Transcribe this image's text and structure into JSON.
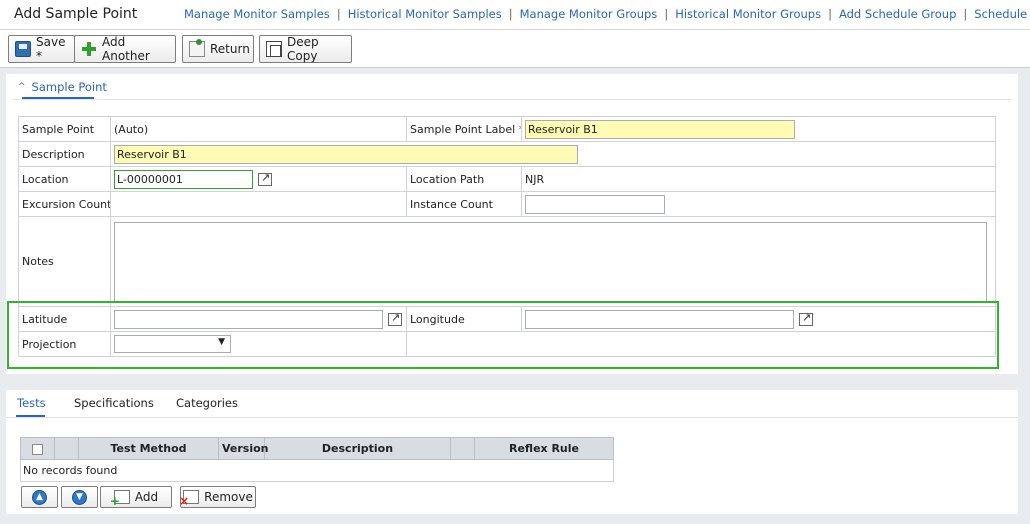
{
  "header": {
    "title": "Add Sample Point",
    "links": [
      "Manage Monitor Samples",
      "Historical Monitor Samples",
      "Manage Monitor Groups",
      "Historical Monitor Groups",
      "Add Schedule Group",
      "Schedule Groups"
    ],
    "separator": "|"
  },
  "toolbar": {
    "save": "Save *",
    "add_another": "Add Another",
    "return": "Return",
    "deep_copy": "Deep Copy"
  },
  "section": {
    "title": "Sample Point"
  },
  "form": {
    "sample_point_label": "Sample Point",
    "sample_point_value": "(Auto)",
    "sample_point_label_label": "Sample Point Label",
    "required_marker": "*",
    "sample_point_label_value": "Reservoir B1",
    "description_label": "Description",
    "description_value": "Reservoir B1",
    "location_label": "Location",
    "location_value": "L-00000001",
    "location_path_label": "Location Path",
    "location_path_value": "NJR",
    "excursion_count_label": "Excursion Count",
    "excursion_count_value": "",
    "instance_count_label": "Instance Count",
    "instance_count_value": "",
    "notes_label": "Notes",
    "notes_value": "",
    "latitude_label": "Latitude",
    "latitude_value": "",
    "longitude_label": "Longitude",
    "longitude_value": "",
    "projection_label": "Projection",
    "projection_value": ""
  },
  "tabs": [
    "Tests",
    "Specifications",
    "Categories"
  ],
  "grid": {
    "columns": [
      "Test Method",
      "Version",
      "Description",
      "Reflex Rule"
    ],
    "empty_message": "No records found"
  },
  "grid_buttons": {
    "add": "Add",
    "remove": "Remove"
  },
  "colors": {
    "link": "#2a66b3",
    "highlight": "#34b233",
    "required_field": "#fffbb5"
  }
}
